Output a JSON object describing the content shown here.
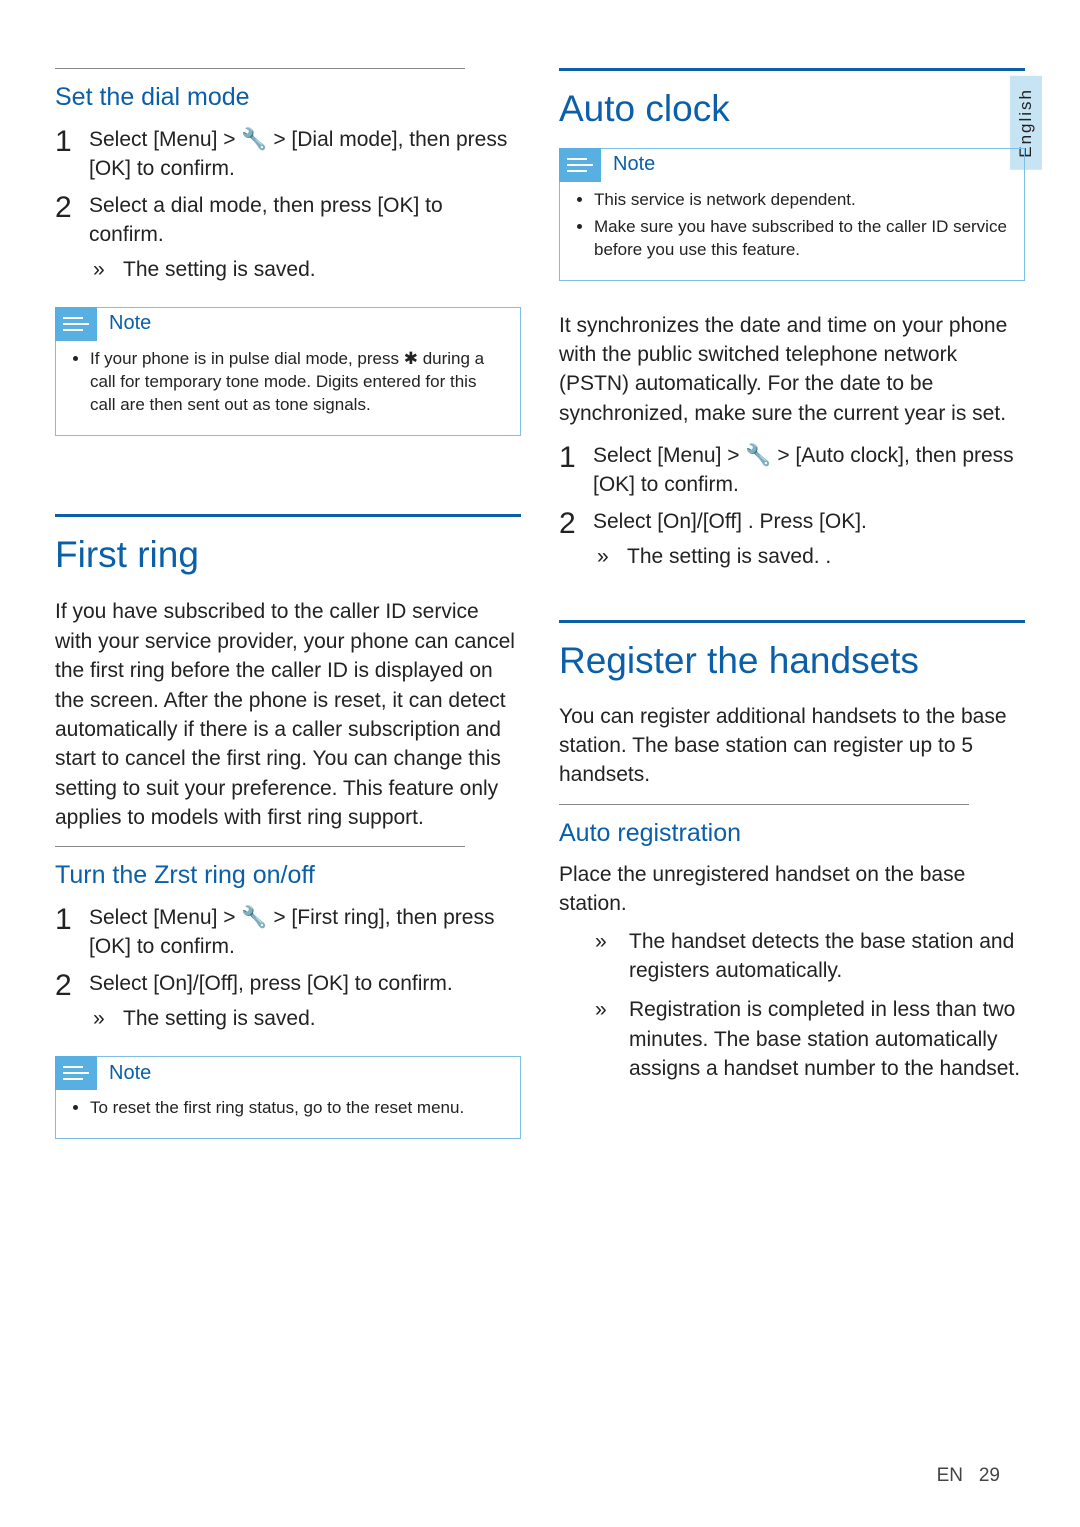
{
  "langTab": "English",
  "left": {
    "sub1": "Set the dial mode",
    "step1_1": "Select [Menu] > 🔧 > [Dial mode], then press [OK] to confirm.",
    "step1_2": "Select a dial mode, then press [OK] to confirm.",
    "result1": "The setting is saved.",
    "noteLabel": "Note",
    "note1": "If your phone is in pulse dial mode, press ✱ during a call for temporary tone mode. Digits entered for this call are then sent out as tone signals.",
    "main1": "First ring",
    "para1": "If you have subscribed to the caller ID service with your service provider, your phone can cancel the first ring before the caller ID is displayed on the screen. After the phone is reset, it can detect automatically if there is a caller subscription and start to cancel the first ring. You can change this setting to suit your preference. This feature only applies to models with first ring support.",
    "sub2": "Turn the Zrst ring on/off",
    "step2_1": "Select [Menu] > 🔧 > [First ring], then press [OK] to confirm.",
    "step2_2": "Select [On]/[Off], press [OK] to confirm.",
    "result2": "The setting is saved.",
    "note2": "To reset the first ring status, go to the reset menu."
  },
  "right": {
    "main1": "Auto clock",
    "noteLabel": "Note",
    "note1a": "This service is network dependent.",
    "note1b": "Make sure you have subscribed to the caller ID service before you use this feature.",
    "para1": "It synchronizes the date and time on your phone with the public switched telephone network (PSTN) automatically. For the date to be synchronized, make sure the current year is set.",
    "step1_1": "Select [Menu] > 🔧 > [Auto clock], then press [OK] to confirm.",
    "step1_2": "Select [On]/[Off] . Press [OK].",
    "result1": "The setting is saved. .",
    "main2": "Register the handsets",
    "para2": "You can register additional handsets to the base station. The base station can register up to 5 handsets.",
    "sub1": "Auto registration",
    "para3": "Place the unregistered handset on the base station.",
    "bullet1": "The handset detects the base station and registers automatically.",
    "bullet2": "Registration is completed in less than two minutes. The base station automatically assigns a handset number to the handset."
  },
  "footer": {
    "lang": "EN",
    "page": "29"
  }
}
